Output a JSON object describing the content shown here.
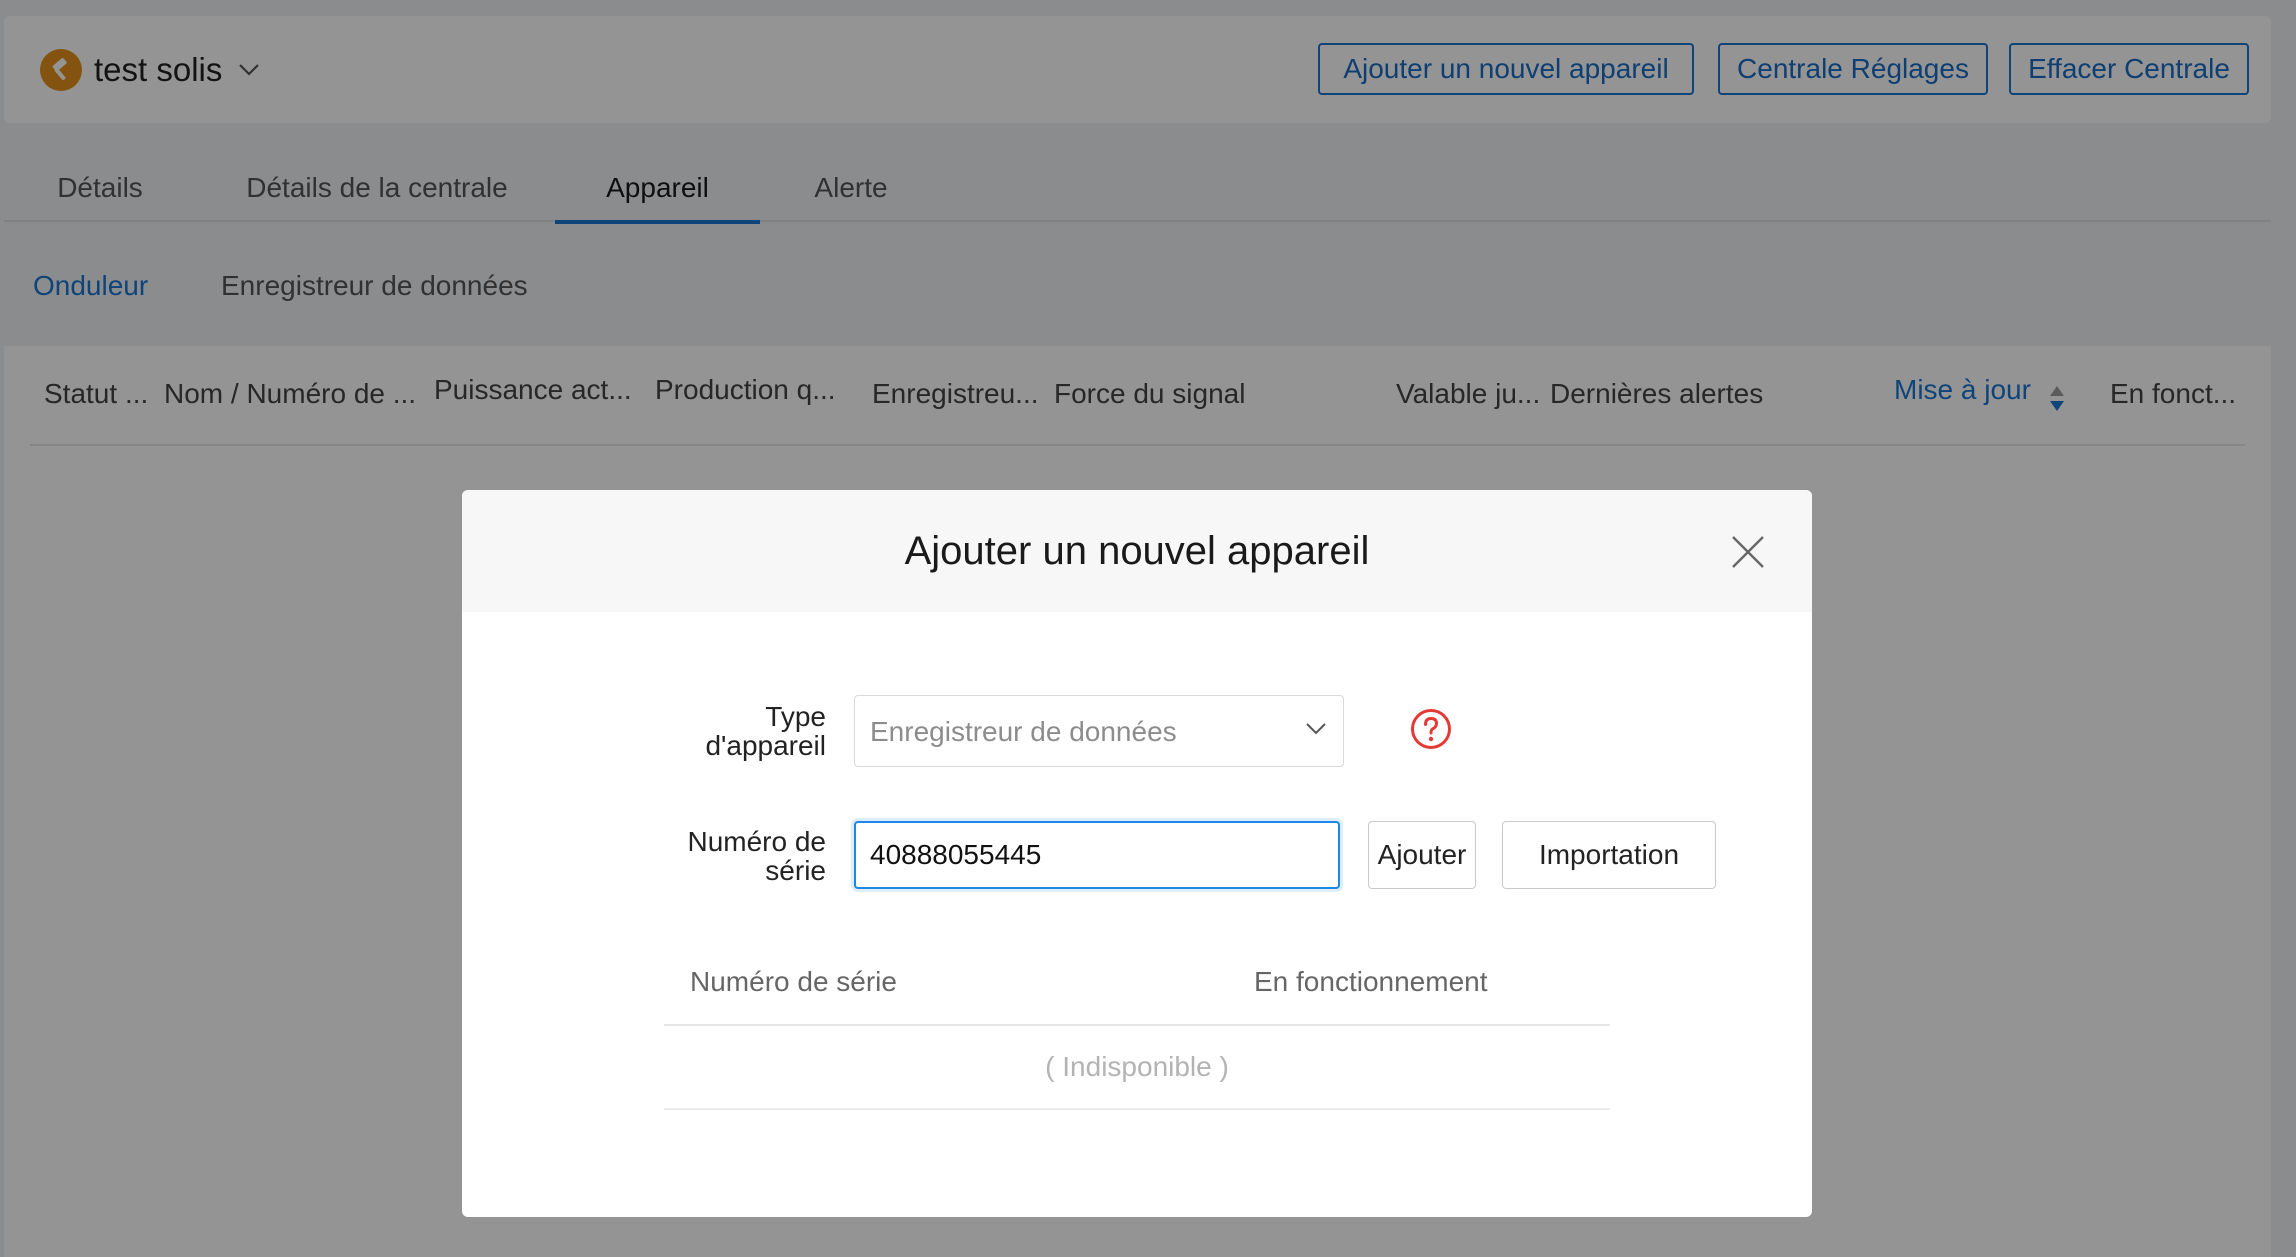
{
  "station": {
    "name": "test solis",
    "icon": "station-hammer-icon"
  },
  "header_buttons": {
    "add_device": "Ajouter un nouvel appareil",
    "settings": "Centrale Réglages",
    "delete": "Effacer Centrale"
  },
  "tabs": [
    {
      "label": "Détails"
    },
    {
      "label": "Détails de la centrale"
    },
    {
      "label": "Appareil",
      "active": true
    },
    {
      "label": "Alerte"
    }
  ],
  "subtabs": [
    {
      "label": "Onduleur",
      "active": true
    },
    {
      "label": "Enregistreur de données"
    }
  ],
  "table_columns": [
    "Statut ...",
    "Nom / Numéro de ...",
    "Puissance act...",
    "Production q...",
    "Enregistreu...",
    "Force du signal",
    "Valable ju...",
    "Dernières alertes",
    "Mise à jour",
    "En fonct..."
  ],
  "modal": {
    "title": "Ajouter un nouvel appareil",
    "type_label_line1": "Type",
    "type_label_line2": "d'appareil",
    "type_value": "Enregistreur de données",
    "serial_label_line1": "Numéro de",
    "serial_label_line2": "série",
    "serial_value": "40888055445",
    "add_button": "Ajouter",
    "import_button": "Importation",
    "inner_table": {
      "columns": [
        "Numéro de série",
        "En fonctionnement"
      ],
      "empty_text": "( Indisponible )"
    }
  },
  "colors": {
    "accent": "#1976d2",
    "station_icon": "#e3901a",
    "help_icon": "#e53935",
    "overlay": "rgba(0,0,0,0.42)"
  }
}
